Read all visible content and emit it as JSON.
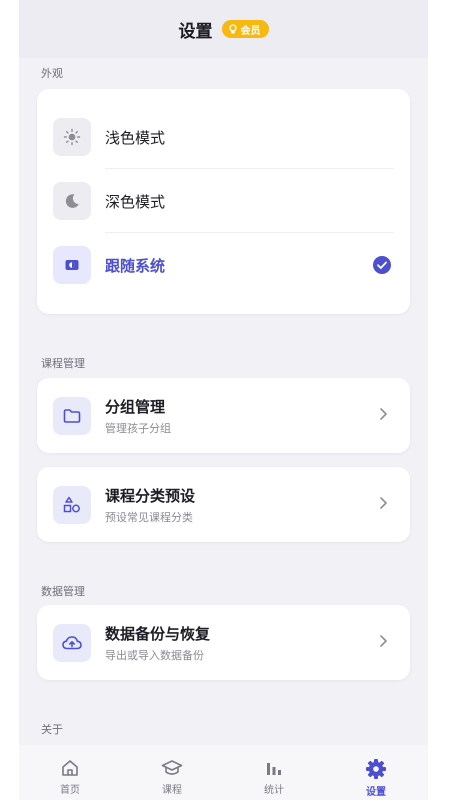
{
  "header": {
    "title": "设置",
    "badge": "会员"
  },
  "sections": {
    "appearance": "外观",
    "course": "课程管理",
    "data": "数据管理",
    "about": "关于"
  },
  "theme_options": [
    {
      "label": "浅色模式",
      "icon": "sun-icon",
      "selected": false
    },
    {
      "label": "深色模式",
      "icon": "moon-icon",
      "selected": false
    },
    {
      "label": "跟随系统",
      "icon": "system-theme-icon",
      "selected": true
    }
  ],
  "course_items": [
    {
      "title": "分组管理",
      "subtitle": "管理孩子分组",
      "icon": "folder-icon"
    },
    {
      "title": "课程分类预设",
      "subtitle": "预设常见课程分类",
      "icon": "shapes-icon"
    }
  ],
  "data_items": [
    {
      "title": "数据备份与恢复",
      "subtitle": "导出或导入数据备份",
      "icon": "cloud-upload-icon"
    }
  ],
  "tabs": [
    {
      "label": "首页",
      "icon": "home-icon",
      "active": false
    },
    {
      "label": "课程",
      "icon": "graduation-cap-icon",
      "active": false
    },
    {
      "label": "统计",
      "icon": "bar-chart-icon",
      "active": false
    },
    {
      "label": "设置",
      "icon": "gear-icon",
      "active": true
    }
  ],
  "colors": {
    "accent": "#4d4fd1",
    "badge": "#f7b90f",
    "background": "#f1f1f6"
  }
}
